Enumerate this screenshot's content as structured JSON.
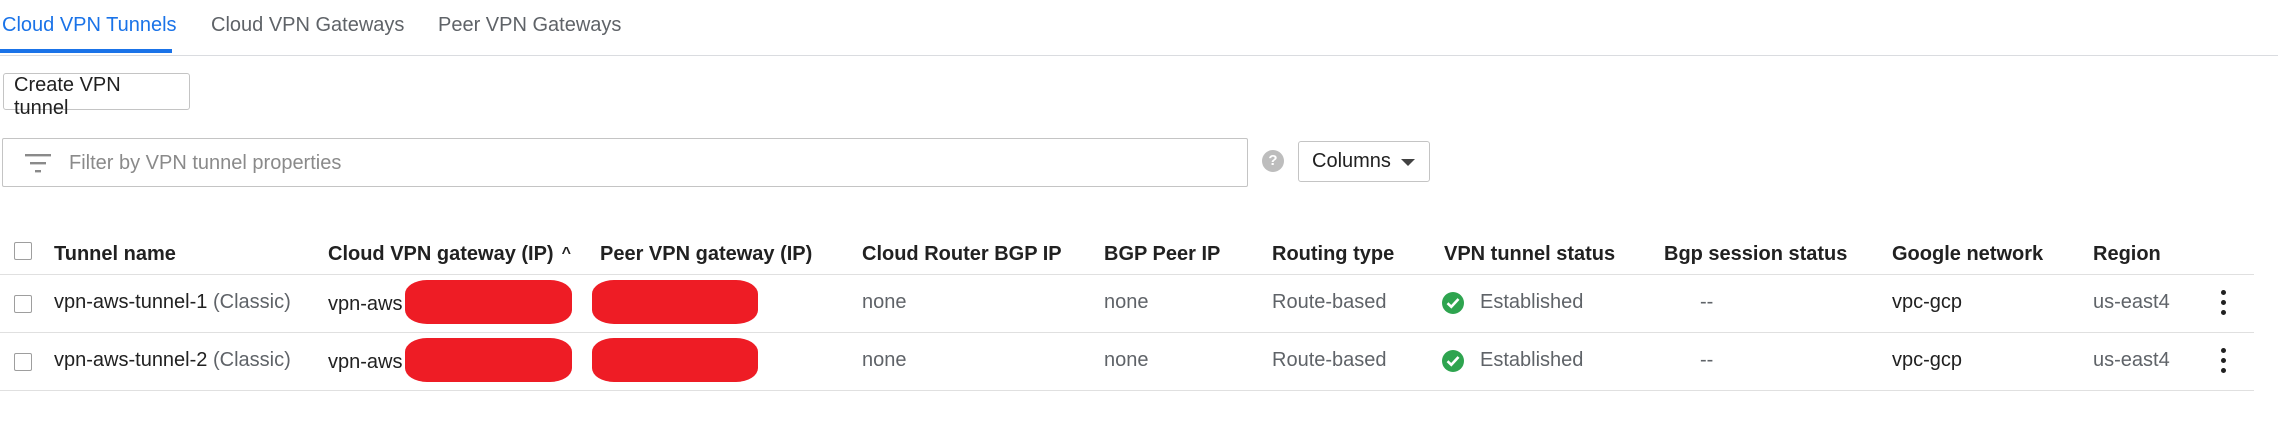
{
  "tabs": [
    {
      "label": "Cloud VPN Tunnels",
      "active": true
    },
    {
      "label": "Cloud VPN Gateways",
      "active": false
    },
    {
      "label": "Peer VPN Gateways",
      "active": false
    }
  ],
  "toolbar": {
    "create_label": "Create VPN tunnel"
  },
  "filter": {
    "placeholder": "Filter by VPN tunnel properties",
    "icon": "filter-list-icon"
  },
  "help": {
    "icon": "help-icon",
    "glyph": "?"
  },
  "columns_button": {
    "label": "Columns"
  },
  "table": {
    "headers": [
      "Tunnel name",
      "Cloud VPN gateway (IP)",
      "Peer VPN gateway (IP)",
      "Cloud Router BGP IP",
      "BGP Peer IP",
      "Routing type",
      "VPN tunnel status",
      "Bgp session status",
      "Google network",
      "Region"
    ],
    "sort_arrow": "^",
    "rows": [
      {
        "name": "vpn-aws-tunnel-1",
        "type": "(Classic)",
        "gateway": "vpn-aws",
        "router_bgp_ip": "none",
        "bgp_peer_ip": "none",
        "routing_type": "Route-based",
        "status": "Established",
        "bgp_session": "--",
        "network": "vpc-gcp",
        "region": "us-east4"
      },
      {
        "name": "vpn-aws-tunnel-2",
        "type": "(Classic)",
        "gateway": "vpn-aws",
        "router_bgp_ip": "none",
        "bgp_peer_ip": "none",
        "routing_type": "Route-based",
        "status": "Established",
        "bgp_session": "--",
        "network": "vpc-gcp",
        "region": "us-east4"
      }
    ]
  },
  "colors": {
    "accent": "#1a73e8",
    "success": "#2ea44f",
    "redaction": "#ee1c25"
  }
}
